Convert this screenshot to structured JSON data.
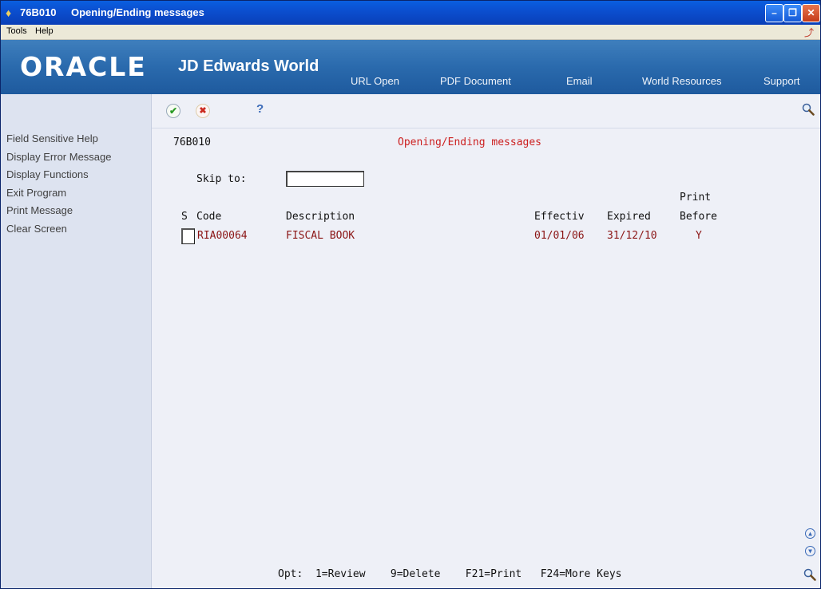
{
  "window": {
    "program_code": "76B010",
    "title": "Opening/Ending messages"
  },
  "menu": {
    "tools": "Tools",
    "help": "Help"
  },
  "banner": {
    "oracle": "ORACLE",
    "product": "JD Edwards World",
    "nav": [
      "URL Open",
      "PDF Document",
      "Email",
      "World Resources",
      "Support"
    ]
  },
  "sidebar": {
    "items": [
      "Field Sensitive Help",
      "Display Error Message",
      "Display Functions",
      "Exit Program",
      "Print Message",
      "Clear Screen"
    ]
  },
  "toolbar": {
    "help_glyph": "?"
  },
  "form": {
    "program_id": "76B010",
    "heading": "Opening/Ending messages",
    "skip_to_label": "Skip to:",
    "skip_to_value": ""
  },
  "grid": {
    "headers": {
      "s": "S",
      "code": "Code",
      "description": "Description",
      "effectiv": "Effectiv",
      "expired": "Expired",
      "print_top": "Print",
      "print_bottom": "Before"
    },
    "rows": [
      {
        "code": "RIA00064",
        "description": "FISCAL BOOK",
        "effectiv": "01/01/06",
        "expired": "31/12/10",
        "print_before": "Y"
      }
    ]
  },
  "footer": {
    "text": "Opt:  1=Review    9=Delete    F21=Print   F24=More Keys"
  },
  "colors": {
    "title_bar": "#0a5fe0",
    "banner": "#2a6aad",
    "heading_red": "#cc1f1f",
    "row_text": "#8b1515",
    "sidebar_bg": "#dde3f0"
  }
}
